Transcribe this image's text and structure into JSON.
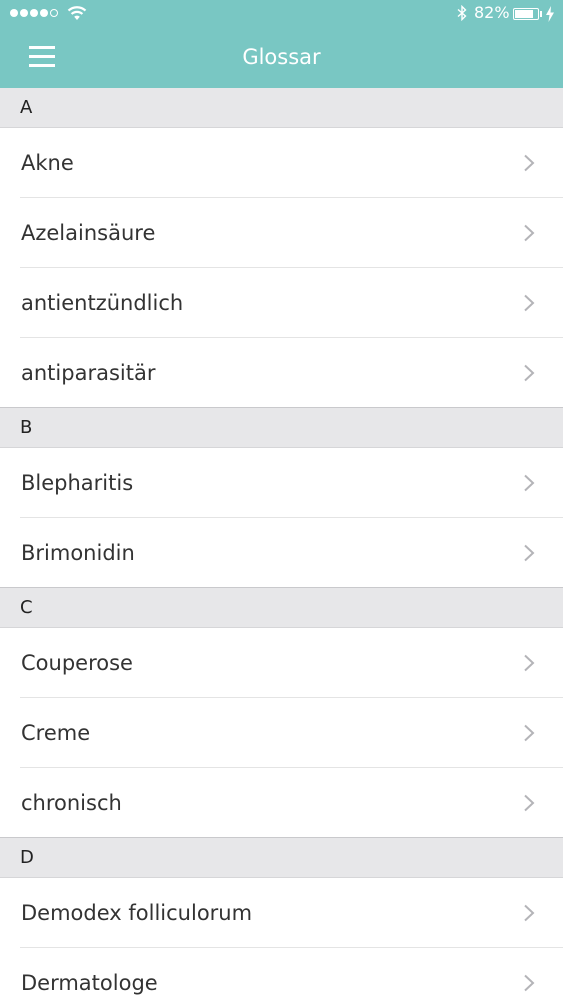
{
  "status_bar": {
    "battery_text": "82%",
    "battery_level": 0.82,
    "signal_bars_filled": 4,
    "signal_bars_total": 5
  },
  "nav": {
    "title": "Glossar",
    "menu_icon": "hamburger-menu-icon"
  },
  "colors": {
    "header": "#79c7c3",
    "section_header": "#e7e7e9",
    "text": "#333333",
    "chevron": "#b4b4b8"
  },
  "glossary": {
    "sections": [
      {
        "letter": "A",
        "items": [
          "Akne",
          "Azelainsäure",
          "antientzündlich",
          "antiparasitär"
        ]
      },
      {
        "letter": "B",
        "items": [
          "Blepharitis",
          "Brimonidin"
        ]
      },
      {
        "letter": "C",
        "items": [
          "Couperose",
          "Creme",
          "chronisch"
        ]
      },
      {
        "letter": "D",
        "items": [
          "Demodex folliculorum",
          "Dermatologe"
        ]
      }
    ]
  }
}
